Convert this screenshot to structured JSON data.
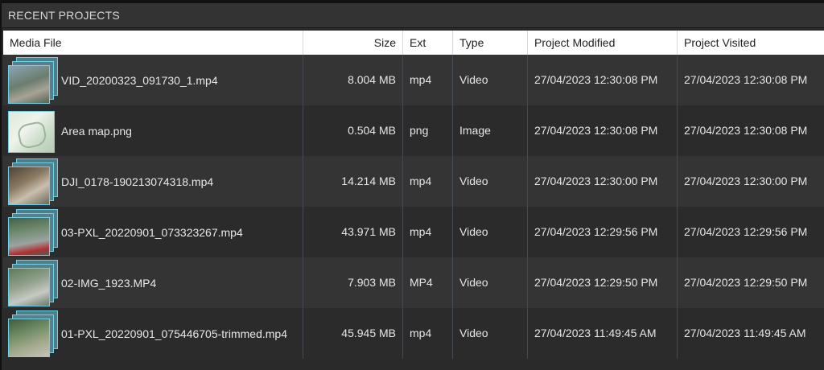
{
  "panel": {
    "title": "RECENT PROJECTS"
  },
  "columns": {
    "media_file": "Media File",
    "size": "Size",
    "ext": "Ext",
    "type": "Type",
    "project_modified": "Project Modified",
    "project_visited": "Project Visited"
  },
  "rows": [
    {
      "name": "VID_20200323_091730_1.mp4",
      "size": "8.004 MB",
      "ext": "mp4",
      "type": "Video",
      "modified": "27/04/2023 12:30:08 PM",
      "visited": "27/04/2023 12:30:08 PM",
      "thumb_icon": "video-stack-icon"
    },
    {
      "name": "Area map.png",
      "size": "0.504 MB",
      "ext": "png",
      "type": "Image",
      "modified": "27/04/2023 12:30:08 PM",
      "visited": "27/04/2023 12:30:08 PM",
      "thumb_icon": "image-thumbnail-icon"
    },
    {
      "name": "DJI_0178-190213074318.mp4",
      "size": "14.214 MB",
      "ext": "mp4",
      "type": "Video",
      "modified": "27/04/2023 12:30:00 PM",
      "visited": "27/04/2023 12:30:00 PM",
      "thumb_icon": "video-stack-icon"
    },
    {
      "name": "03-PXL_20220901_073323267.mp4",
      "size": "43.971 MB",
      "ext": "mp4",
      "type": "Video",
      "modified": "27/04/2023 12:29:56 PM",
      "visited": "27/04/2023 12:29:56 PM",
      "thumb_icon": "video-stack-icon"
    },
    {
      "name": "02-IMG_1923.MP4",
      "size": "7.903 MB",
      "ext": "MP4",
      "type": "Video",
      "modified": "27/04/2023 12:29:50 PM",
      "visited": "27/04/2023 12:29:50 PM",
      "thumb_icon": "video-stack-icon"
    },
    {
      "name": "01-PXL_20220901_075446705-trimmed.mp4",
      "size": "45.945 MB",
      "ext": "mp4",
      "type": "Video",
      "modified": "27/04/2023 11:49:45 AM",
      "visited": "27/04/2023 11:49:45 AM",
      "thumb_icon": "video-stack-icon"
    }
  ],
  "colors": {
    "panel_bg": "#2a2a2a",
    "header_bg": "#ffffff",
    "row_odd": "#343434",
    "row_even": "#2b2b2b",
    "thumb_border": "#6fd0e8"
  }
}
